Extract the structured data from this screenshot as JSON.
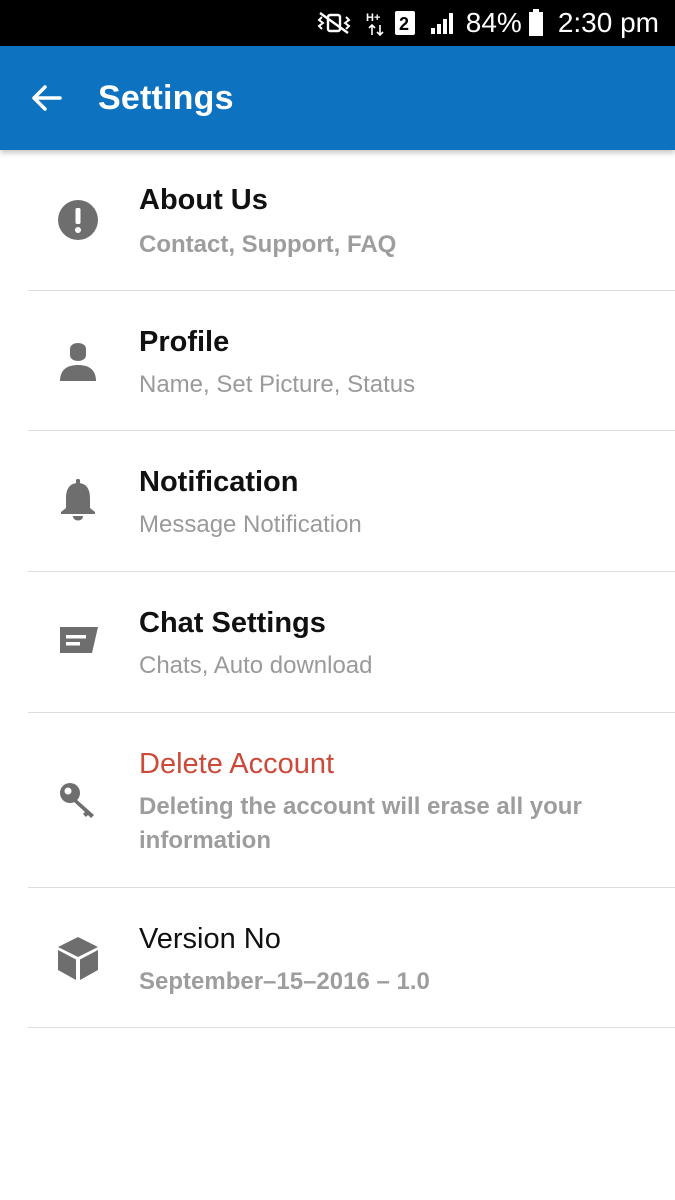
{
  "status_bar": {
    "battery_percent": "84%",
    "time": "2:30 pm",
    "sim_slot": "2",
    "network": "H+",
    "icons": [
      "vibrate-icon",
      "network-hplus-icon",
      "sim-2-icon",
      "signal-icon",
      "battery-icon"
    ]
  },
  "app_bar": {
    "title": "Settings",
    "back_icon": "arrow-left-icon",
    "color": "#0d72bf"
  },
  "settings": {
    "items": [
      {
        "title": "About Us",
        "subtitle": "Contact, Support, FAQ",
        "icon": "alert-circle-icon"
      },
      {
        "title": "Profile",
        "subtitle": "Name, Set Picture, Status",
        "icon": "person-icon"
      },
      {
        "title": "Notification",
        "subtitle": "Message Notification",
        "icon": "bell-icon"
      },
      {
        "title": "Chat Settings",
        "subtitle": "Chats, Auto download",
        "icon": "chat-icon"
      },
      {
        "title": "Delete Account",
        "subtitle": "Deleting the account will erase all your information",
        "icon": "key-icon"
      },
      {
        "title": "Version No",
        "subtitle": "September–15–2016 – 1.0",
        "icon": "box-icon"
      }
    ]
  },
  "colors": {
    "danger": "#cc4a3a",
    "subtitle": "#9a9a9a",
    "icon": "#6e6e6e"
  }
}
